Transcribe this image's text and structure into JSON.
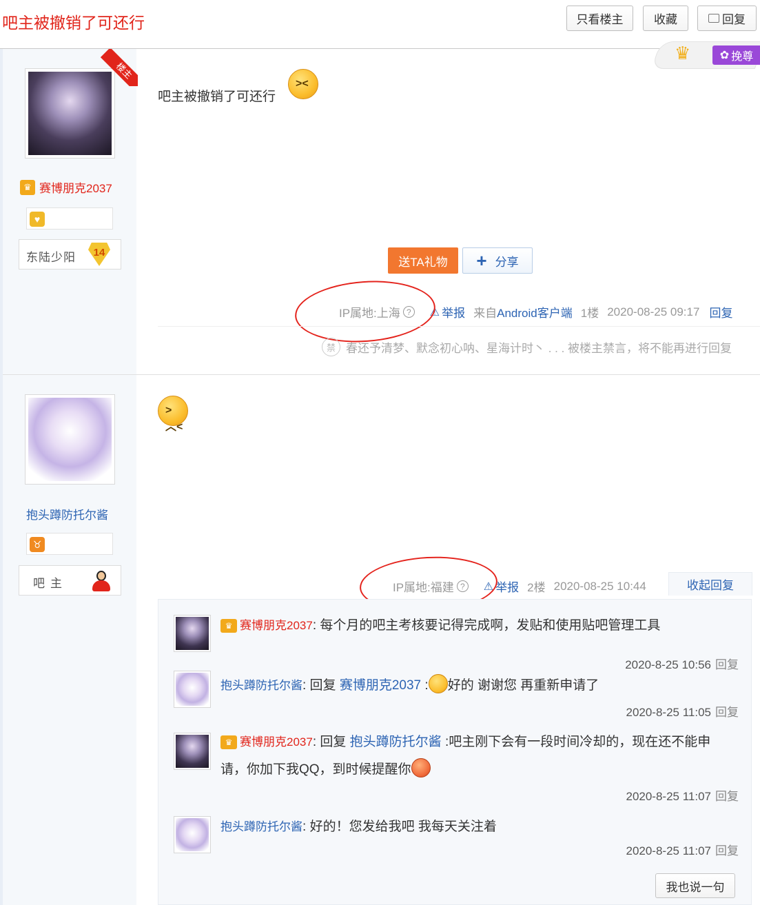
{
  "header": {
    "title": "吧主被撤销了可还行",
    "only_lz": "只看楼主",
    "favorite": "收藏",
    "reply": "回复",
    "pawn_label": "挽尊"
  },
  "posts": [
    {
      "floor_badge": "楼主",
      "user": {
        "name": "赛博朋克2037",
        "rank_title": "东陆少阳",
        "level": "14"
      },
      "content": "吧主被撤销了可还行",
      "gift_label": "送TA礼物",
      "share_label": "分享",
      "ip": "IP属地:上海",
      "help": "?",
      "report": "举报",
      "from_prefix": "来自",
      "from_client": "Android客户端",
      "floor": "1楼",
      "time": "2020-08-25 09:17",
      "reply_link": "回复",
      "banned_notice": "春还予清梦、默念初心呐、星海计时丶 . . . 被楼主禁言，将不能再进行回复",
      "banned_icon": "禁"
    },
    {
      "user": {
        "name": "抱头蹲防托尔酱",
        "rank_title": "吧主"
      },
      "ip": "IP属地:福建",
      "help": "?",
      "report": "举报",
      "floor": "2楼",
      "time": "2020-08-25 10:44",
      "collapse_link": "收起回复"
    }
  ],
  "replies": [
    {
      "user": "赛博朋克2037",
      "sep": ": ",
      "text": "每个月的吧主考核要记得完成啊，发贴和使用贴吧管理工具",
      "time": "2020-8-25 10:56",
      "reply": "回复"
    },
    {
      "user": "抱头蹲防托尔酱",
      "sep": ": 回复 ",
      "target": "赛博朋克2037",
      "colon": " :",
      "text": "好的 谢谢您 再重新申请了",
      "time": "2020-8-25 11:05",
      "reply": "回复"
    },
    {
      "user": "赛博朋克2037",
      "sep": ": 回复 ",
      "target": "抱头蹲防托尔酱",
      "colon": " :",
      "text": "吧主刚下会有一段时间冷却的，现在还不能申请，你加下我QQ，到时候提醒你",
      "time": "2020-8-25 11:07",
      "reply": "回复"
    },
    {
      "user": "抱头蹲防托尔酱",
      "sep": ": ",
      "text": "好的！您发给我吧 我每天关注着",
      "time": "2020-8-25 11:07",
      "reply": "回复"
    }
  ],
  "say_button": "我也说一句"
}
